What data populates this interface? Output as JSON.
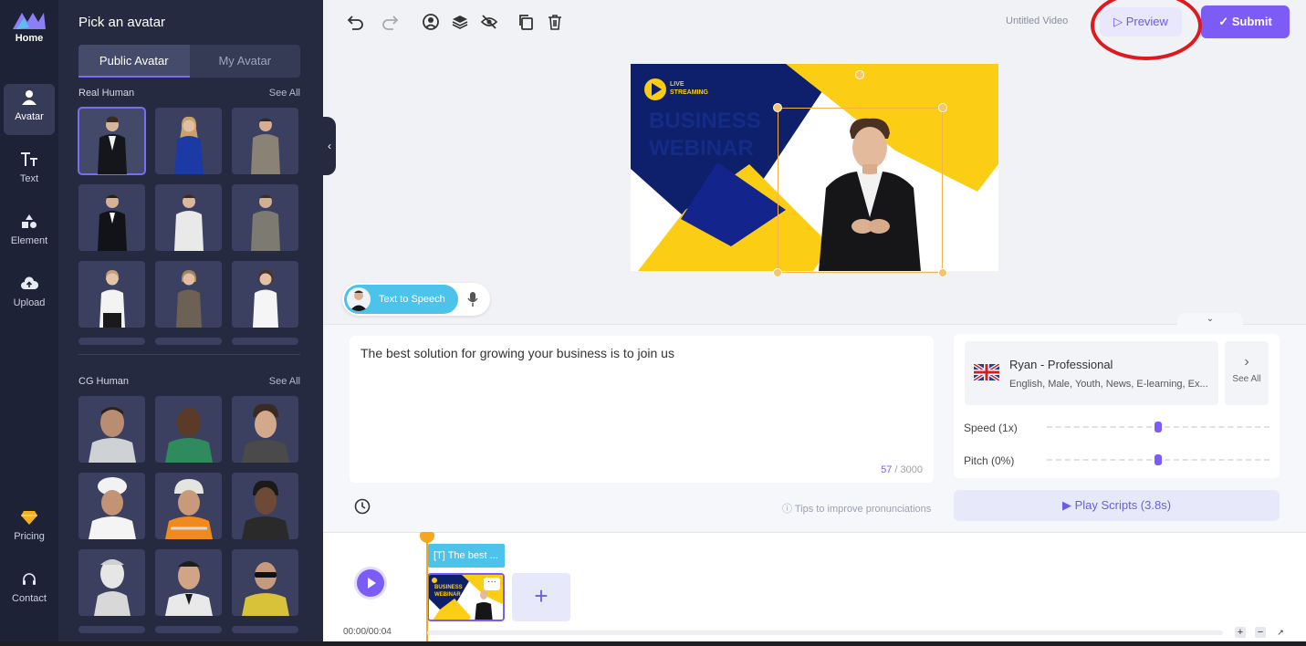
{
  "rail": {
    "home_label": "Home",
    "items": [
      {
        "label": "Avatar",
        "icon": "person-icon"
      },
      {
        "label": "Text",
        "icon": "text-icon"
      },
      {
        "label": "Element",
        "icon": "shapes-icon"
      },
      {
        "label": "Upload",
        "icon": "cloud-upload-icon"
      },
      {
        "label": "Pricing",
        "icon": "diamond-icon"
      },
      {
        "label": "Contact",
        "icon": "headset-icon"
      }
    ]
  },
  "panel": {
    "title": "Pick an avatar",
    "tabs": [
      {
        "label": "Public Avatar",
        "active": true
      },
      {
        "label": "My Avatar",
        "active": false
      }
    ],
    "sections": [
      {
        "title": "Real Human",
        "see_all": "See All"
      },
      {
        "title": "CG Human",
        "see_all": "See All"
      }
    ]
  },
  "toolbar": {
    "icons": [
      "undo-icon",
      "redo-icon",
      "avatar-icon",
      "layers-icon",
      "hide-icon",
      "copy-icon",
      "delete-icon"
    ],
    "video_title": "Untitled Video",
    "preview_label": "Preview",
    "submit_label": "Submit"
  },
  "canvas": {
    "badge_line1": "LIVE",
    "badge_line2": "STREAMING",
    "headline_line1": "BUSINESS",
    "headline_line2": "WEBINAR"
  },
  "tts": {
    "label": "Text to Speech"
  },
  "script": {
    "text": "The best solution for growing your business is to join us",
    "count_current": "57",
    "count_max": " / 3000",
    "tips": "Tips to improve pronunciations"
  },
  "voice": {
    "name": "Ryan - Professional",
    "tags": "English, Male, Youth, News, E-learning, Ex...",
    "see_all": "See All",
    "speed_label": "Speed (1x)",
    "pitch_label": "Pitch (0%)",
    "speed_value": 0.5,
    "pitch_value": 0.5,
    "play_label": "Play Scripts (3.8s)"
  },
  "timeline": {
    "time": "00:00/00:04",
    "text_clip": "The best ...",
    "thumb_title": "BUSINESS WEBINAR",
    "add_label": "+",
    "more_label": "···"
  },
  "colors": {
    "accent": "#7b5cf5",
    "cyan": "#4bc3ea",
    "navy": "#0e1f6b",
    "yellow": "#fbcd14",
    "highlight_ring": "#e0191e"
  }
}
